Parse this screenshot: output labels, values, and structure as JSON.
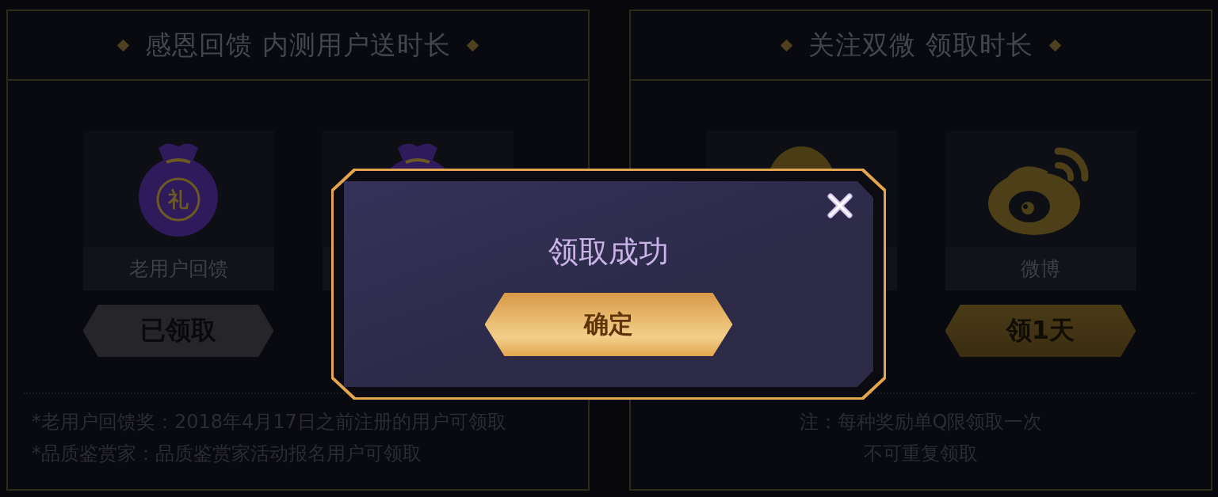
{
  "panels": [
    {
      "title": "感恩回馈 内测用户送时长",
      "cards": [
        {
          "kind": "bag",
          "badge": "礼",
          "label": "老用户回馈",
          "button": {
            "label": "已领取",
            "claimed": true
          }
        },
        {
          "kind": "bag"
        }
      ],
      "notes": [
        "*老用户回馈奖：2018年4月17日之前注册的用户可领取",
        "*品质鉴赏家：品质鉴赏家活动报名用户可领取"
      ]
    },
    {
      "title": "关注双微 领取时长",
      "cards": [
        {
          "kind": "penguin"
        },
        {
          "kind": "weibo",
          "label": "微博",
          "button": {
            "label": "领1天",
            "claimed": false
          }
        }
      ],
      "notes": [
        "注：每种奖励单Q限领取一次",
        "不可重复领取"
      ]
    }
  ],
  "dialog": {
    "title": "领取成功",
    "button": "确定"
  }
}
